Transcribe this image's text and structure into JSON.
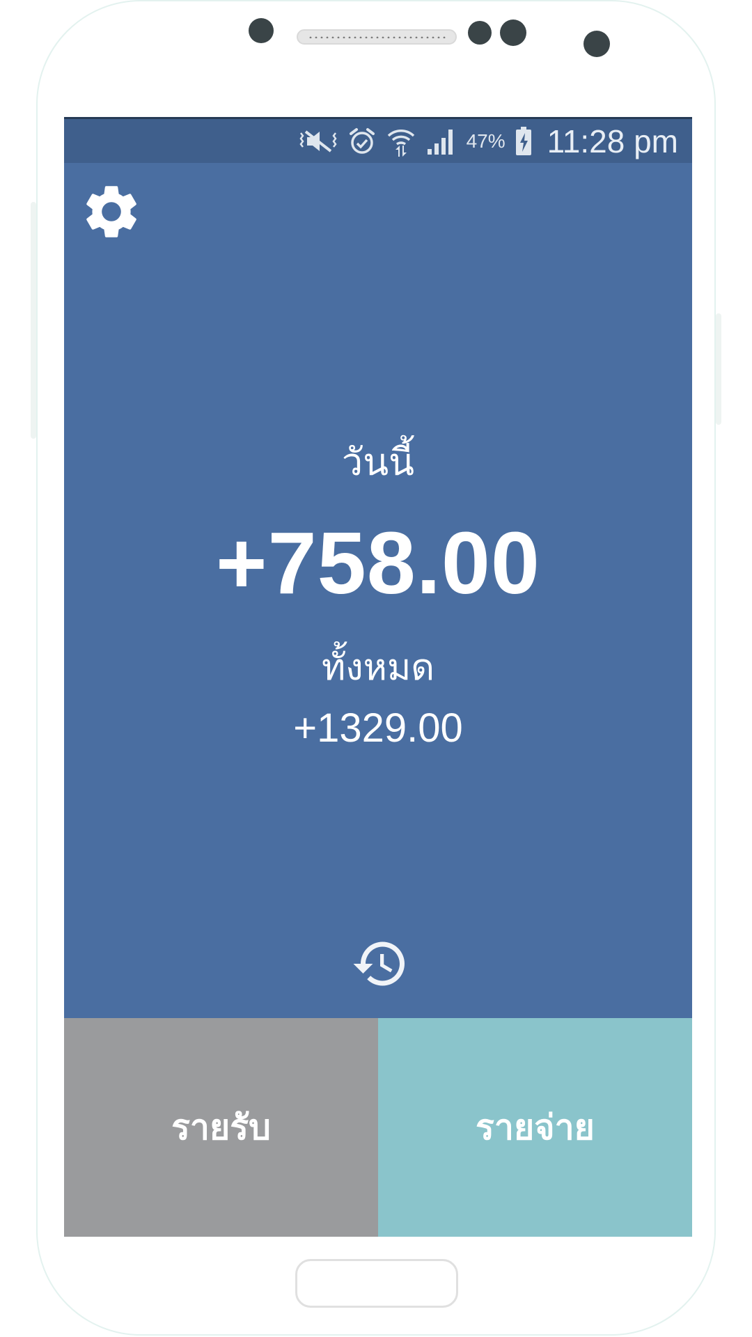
{
  "status_bar": {
    "icons": [
      "mute-vibrate-icon",
      "alarm-icon",
      "wifi-icon",
      "signal-icon",
      "battery-charging-icon"
    ],
    "battery": "47%",
    "time": "11:28 pm"
  },
  "toolbar": {
    "settings_icon": "gear-icon"
  },
  "summary": {
    "today_label": "วันนี้",
    "today_value": "+758.00",
    "total_label": "ทั้งหมด",
    "total_value": "+1329.00"
  },
  "history": {
    "icon": "history-icon"
  },
  "actions": {
    "income_label": "รายรับ",
    "expense_label": "รายจ่าย"
  },
  "colors": {
    "background": "#4a6ea1",
    "status_bar": "#3f5f8c",
    "income_button": "#9a9b9d",
    "expense_button": "#8ac4cb",
    "text": "#ffffff"
  }
}
